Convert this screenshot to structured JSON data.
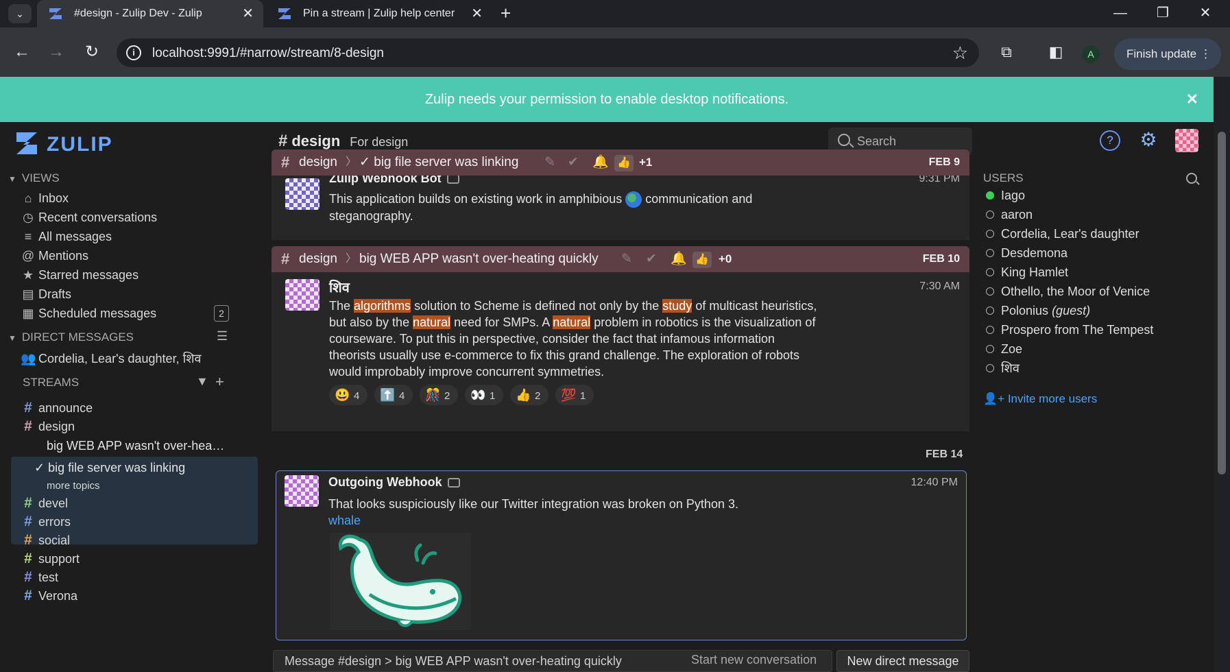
{
  "browser": {
    "tabs": [
      {
        "title": "#design - Zulip Dev - Zulip",
        "active": true
      },
      {
        "title": "Pin a stream | Zulip help center",
        "active": false
      }
    ],
    "url": "localhost:9991/#narrow/stream/8-design",
    "finish_update_label": "Finish update",
    "profile_initial": "A"
  },
  "banner": {
    "text": "Zulip needs your permission to enable desktop notifications."
  },
  "header": {
    "logo_text": "ZULIP",
    "stream_name": "design",
    "stream_description": "For design",
    "search_placeholder": "Search",
    "help_label": "?"
  },
  "left_sidebar": {
    "views_heading": "VIEWS",
    "views": [
      {
        "label": "Inbox",
        "icon": "inbox-icon"
      },
      {
        "label": "Recent conversations",
        "icon": "clock-icon"
      },
      {
        "label": "All messages",
        "icon": "all-messages-icon"
      },
      {
        "label": "Mentions",
        "icon": "at-icon"
      },
      {
        "label": "Starred messages",
        "icon": "star-icon"
      },
      {
        "label": "Drafts",
        "icon": "drafts-icon"
      },
      {
        "label": "Scheduled messages",
        "icon": "calendar-icon",
        "count": "2"
      }
    ],
    "dm_heading": "DIRECT MESSAGES",
    "direct_messages": [
      {
        "label": "Cordelia, Lear's daughter, शिव"
      }
    ],
    "streams_heading": "STREAMS",
    "streams": [
      {
        "name": "announce",
        "color": "#7b9ee0"
      },
      {
        "name": "design",
        "color": "#d6a6ae"
      },
      {
        "name": "devel",
        "color": "#93d18a"
      },
      {
        "name": "errors",
        "color": "#7b9ee0"
      },
      {
        "name": "social",
        "color": "#e5a559"
      },
      {
        "name": "support",
        "color": "#b8d97a"
      },
      {
        "name": "test",
        "color": "#8a8ef0"
      },
      {
        "name": "Verona",
        "color": "#7bb0e6"
      }
    ],
    "topics": [
      {
        "label": "big WEB APP wasn't over-hea…"
      },
      {
        "label": "✓ big file server was linking"
      }
    ],
    "more_topics": "more topics"
  },
  "messages": {
    "group1": {
      "stream": "design",
      "topic": "✓ big file server was linking",
      "reaction_count": "+1",
      "date": "FEB 9",
      "sender": "Zulip Webhook Bot",
      "time": "9:31 PM",
      "text_before": "This application builds on existing work in amphibious",
      "text_after": "communication and",
      "text_line2": "steganography."
    },
    "group2": {
      "stream": "design",
      "topic": "big WEB APP wasn't over-heating quickly",
      "reaction_count": "+0",
      "date": "FEB 10",
      "sender": "शिव",
      "time": "7:30 AM",
      "t1": "The ",
      "h1": "algorithms",
      "t2": " solution to Scheme is defined not only by the ",
      "h2": "study",
      "t3": " of multicast heuristics,",
      "t4": "but also by the ",
      "h3": "natural",
      "t5": " need for SMPs. A ",
      "h4": "natural",
      "t6": " problem in robotics is the visualization of",
      "t7": "courseware. To put this in perspective, consider the fact that infamous information",
      "t8": "theorists usually use e-commerce to fix this grand challenge. The exploration of robots",
      "t9": "would improbably improve concurrent symmetries.",
      "reactions": [
        {
          "emoji": "😃",
          "count": "4"
        },
        {
          "emoji": "⬆️",
          "count": "4"
        },
        {
          "emoji": "🎊",
          "count": "2"
        },
        {
          "emoji": "👀",
          "count": "1"
        },
        {
          "emoji": "👍",
          "count": "2"
        },
        {
          "emoji": "💯",
          "count": "1"
        }
      ]
    },
    "group3": {
      "date": "FEB 14",
      "sender": "Outgoing Webhook",
      "time": "12:40 PM",
      "text": "That looks suspiciously like our Twitter integration was broken on Python 3.",
      "link": "whale"
    }
  },
  "compose": {
    "placeholder": "Message #design > big WEB APP wasn't over-heating quickly",
    "start_new": "Start new conversation",
    "new_dm": "New direct message"
  },
  "right_sidebar": {
    "heading": "USERS",
    "users": [
      {
        "name": "Iago",
        "active": true
      },
      {
        "name": "aaron",
        "active": false
      },
      {
        "name": "Cordelia, Lear's daughter",
        "active": false
      },
      {
        "name": "Desdemona",
        "active": false
      },
      {
        "name": "King Hamlet",
        "active": false
      },
      {
        "name": "Othello, the Moor of Venice",
        "active": false
      },
      {
        "name": "Polonius",
        "suffix": "(guest)",
        "active": false
      },
      {
        "name": "Prospero from The Tempest",
        "active": false
      },
      {
        "name": "Zoe",
        "active": false
      },
      {
        "name": "शिव",
        "active": false
      }
    ],
    "invite": "Invite more users"
  }
}
